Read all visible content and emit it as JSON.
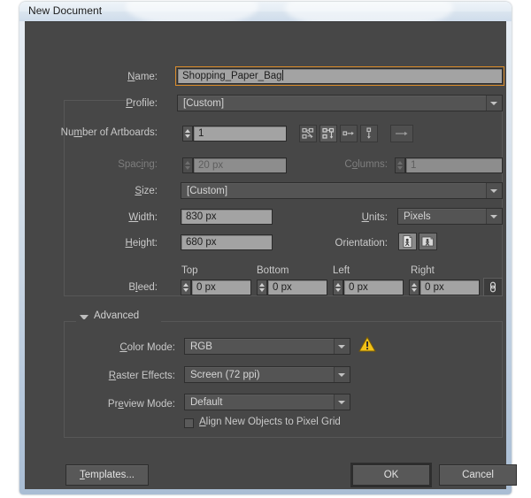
{
  "window": {
    "title": "New Document"
  },
  "fields": {
    "name": {
      "label": "Name:",
      "value": "Shopping_Paper_Bag"
    },
    "profile": {
      "label": "Profile:",
      "value": "[Custom]"
    },
    "artboards": {
      "label": "Number of Artboards:",
      "value": "1"
    },
    "spacing": {
      "label": "Spacing:",
      "value": "20 px"
    },
    "columns": {
      "label": "Columns:",
      "value": "1"
    },
    "size": {
      "label": "Size:",
      "value": "[Custom]"
    },
    "width": {
      "label": "Width:",
      "value": "830 px"
    },
    "height": {
      "label": "Height:",
      "value": "680 px"
    },
    "units": {
      "label": "Units:",
      "value": "Pixels"
    },
    "orientation": {
      "label": "Orientation:"
    },
    "bleed": {
      "label": "Bleed:",
      "headers": [
        "Top",
        "Bottom",
        "Left",
        "Right"
      ],
      "values": [
        "0 px",
        "0 px",
        "0 px",
        "0 px"
      ]
    }
  },
  "advanced": {
    "header": "Advanced",
    "color_mode": {
      "label": "Color Mode:",
      "value": "RGB"
    },
    "raster_effects": {
      "label": "Raster Effects:",
      "value": "Screen (72 ppi)"
    },
    "preview_mode": {
      "label": "Preview Mode:",
      "value": "Default"
    },
    "align_pixel_grid": {
      "label": "Align New Objects to Pixel Grid",
      "checked": false
    }
  },
  "buttons": {
    "templates": "Templates...",
    "ok": "OK",
    "cancel": "Cancel"
  },
  "icons": {
    "arrange_grid_row": "grid-by-row-icon",
    "arrange_grid_column": "grid-by-column-icon",
    "arrange_row": "arrange-row-icon",
    "arrange_column": "arrange-column-icon",
    "flow_direction": "flow-direction-arrow-icon",
    "orientation_portrait": "portrait-orientation-icon",
    "orientation_landscape": "landscape-orientation-icon",
    "bleed_link": "link-chain-icon",
    "color_warning": "warning-triangle-icon",
    "disclosure": "disclosure-triangle-down-icon"
  },
  "colors": {
    "dialog_bg": "#474747",
    "focus_orange": "#d98b2b",
    "warning_yellow": "#f2c218",
    "input_bg": "#a3a3a3"
  }
}
